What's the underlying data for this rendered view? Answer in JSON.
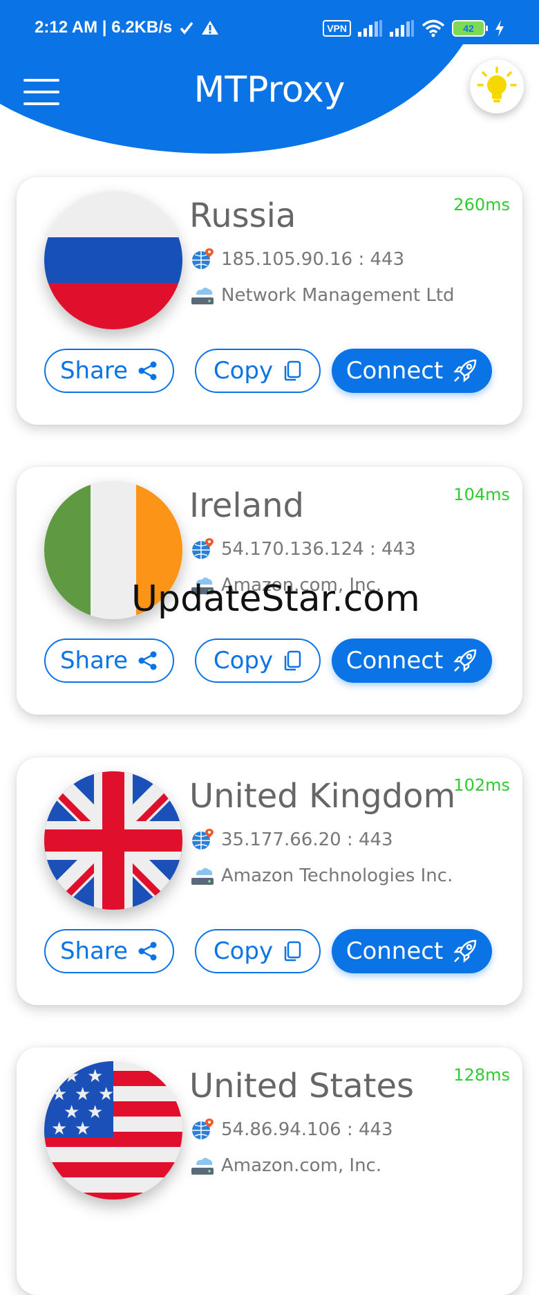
{
  "status_bar": {
    "time_speed": "2:12 AM | 6.2KB/s",
    "vpn": "VPN",
    "battery": "42"
  },
  "header": {
    "title": "MTProxy"
  },
  "colors": {
    "primary": "#0a73e6",
    "ping": "#2ecc2e"
  },
  "actions": {
    "share": "Share",
    "copy": "Copy",
    "connect": "Connect"
  },
  "proxies": [
    {
      "country": "Russia",
      "ping": "260ms",
      "address": "185.105.90.16 : 443",
      "org": "Network Management Ltd",
      "flag": "russia-flag"
    },
    {
      "country": "Ireland",
      "ping": "104ms",
      "address": "54.170.136.124 : 443",
      "org": "Amazon.com, Inc.",
      "flag": "ireland-flag"
    },
    {
      "country": "United Kingdom",
      "ping": "102ms",
      "address": "35.177.66.20 : 443",
      "org": "Amazon Technologies Inc.",
      "flag": "uk-flag"
    },
    {
      "country": "United States",
      "ping": "128ms",
      "address": "54.86.94.106 : 443",
      "org": "Amazon.com, Inc.",
      "flag": "usa-flag"
    }
  ],
  "watermark": "UpdateStar.com"
}
